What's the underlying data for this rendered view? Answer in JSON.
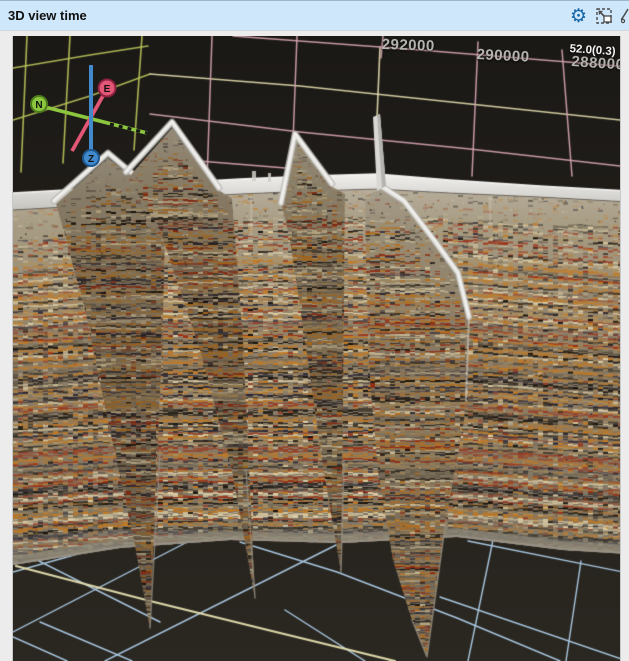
{
  "window": {
    "title": "3D view time",
    "icons": {
      "settings_glyph": "⚙"
    }
  },
  "viewport": {
    "coordinate_labels": [
      {
        "text": "292000"
      },
      {
        "text": "290000"
      },
      {
        "text": "288000"
      }
    ],
    "stat_label": "52.0(0.3)",
    "axes": {
      "north": "N",
      "east": "E",
      "depth": "Z"
    },
    "colors": {
      "titlebar_bg": "#cfe7fa",
      "background_top": "#1b1916",
      "background_mid": "#23201b",
      "background_floor": "#2b2822",
      "grid_pink": "#d2a0b0",
      "grid_lime": "#bdc75b",
      "grid_floor_cyan": "#a9c7e0",
      "grid_cream": "#e7e0b0",
      "axis_north": "#8cc63e",
      "axis_north_dark": "#4e7c1c",
      "axis_east": "#e25776",
      "axis_east_dark": "#8e2040",
      "axis_depth": "#4189ca",
      "axis_depth_dark": "#1c588f",
      "cap_light": "#f1f0ed",
      "cap_dark": "#c6c4bf",
      "seismic_orange": "#c5791e",
      "seismic_black": "#17120c",
      "seismic_red": "#9c2e12",
      "seismic_cream": "#dfd0a8",
      "seismic_navy": "#272433",
      "seismic_tan": "#b3935c",
      "seismic_gray": "#6e6450",
      "fade_gray": "#8a8476"
    }
  }
}
